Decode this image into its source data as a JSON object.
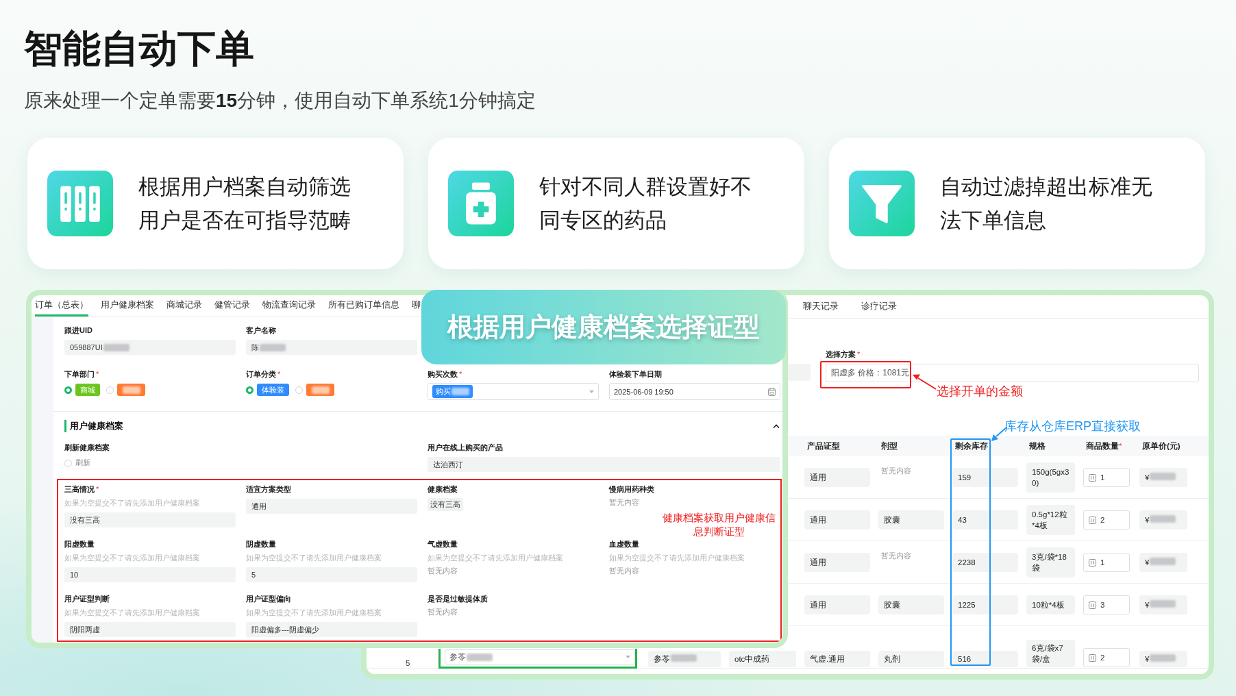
{
  "title": "智能自动下单",
  "subtitle": "原来处理一个定单需要**15**分钟，使用自动下单系统1分钟搞定",
  "features": [
    {
      "kind": "binders",
      "text": "根据用户档案自动筛选用户是否在可指导范畴"
    },
    {
      "kind": "bottle",
      "text": "针对不同人群设置好不同专区的药品"
    },
    {
      "kind": "funnel",
      "text": "自动过滤掉超出标准无法下单信息"
    }
  ],
  "banner": "根据用户健康档案选择证型",
  "order_window": {
    "tabs": [
      {
        "label": "订单（总表）",
        "selected": true
      },
      {
        "label": "用户健康档案",
        "selected": false
      },
      {
        "label": "商城记录",
        "selected": false
      },
      {
        "label": "健管记录",
        "selected": false
      },
      {
        "label": "物流查询记录",
        "selected": false
      },
      {
        "label": "所有已购订单信息",
        "selected": false
      },
      {
        "label": "聊",
        "selected": false
      }
    ],
    "rows": [
      [
        {
          "label": "跟进UID",
          "kind": "input",
          "value": "059887UI",
          "masked": true
        },
        {
          "label": "客户名称",
          "kind": "input",
          "value": "陈",
          "masked": true
        }
      ],
      [
        {
          "label": "下单部门",
          "required_mark": "*",
          "kind": "radio",
          "options": [
            {
              "label": "商城",
              "color": "#6cc51f",
              "selected": true
            },
            {
              "color": "#ff7a33",
              "selected": false,
              "masked": true
            }
          ]
        },
        {
          "label": "订单分类",
          "required_mark": "*",
          "kind": "radio",
          "options": [
            {
              "label": "体验装",
              "color": "#2f8cff",
              "selected": true
            },
            {
              "color": "#ff7a33",
              "selected": false,
              "masked": true
            }
          ]
        },
        {
          "label": "购买次数",
          "required_mark": "*",
          "kind": "select",
          "value": "购买",
          "masked": true
        },
        {
          "label": "体验装下单日期",
          "kind": "date",
          "value": "2025-06-09 19:50"
        }
      ]
    ],
    "health": {
      "title": "用户健康档案",
      "expanded": true,
      "refresh": {
        "label": "刷新健康档案",
        "kind": "radio",
        "options": [
          {
            "label": "刷新",
            "selected": false
          }
        ]
      },
      "purchased": {
        "label": "用户在线上购买的产品",
        "kind": "input",
        "value": "达泊西汀"
      },
      "note": "健康档案获取用户健康信息判断证型",
      "highlight_rows": [
        [
          {
            "label": "三高情况",
            "required_mark": "*",
            "hint": "如果为空提交不了请先添加用户健康档案",
            "kind": "input",
            "value": "没有三高"
          },
          {
            "label": "适宜方案类型",
            "kind": "input",
            "value": "通用"
          },
          {
            "label": "健康档案",
            "kind": "tag",
            "value": "没有三高"
          },
          {
            "label": "慢病用药种类",
            "kind": "text",
            "value": "暂无内容"
          }
        ],
        [
          {
            "label": "阳虚数量",
            "hint": "如果为空提交不了请先添加用户健康档案",
            "kind": "input",
            "value": "10"
          },
          {
            "label": "阴虚数量",
            "hint": "如果为空提交不了请先添加用户健康档案",
            "kind": "input",
            "value": "5"
          },
          {
            "label": "气虚数量",
            "hint": "如果为空提交不了请先添加用户健康档案",
            "kind": "text",
            "value": "暂无内容"
          },
          {
            "label": "血虚数量",
            "hint": "如果为空提交不了请先添加用户健康档案",
            "kind": "text",
            "value": "暂无内容"
          }
        ],
        [
          {
            "label": "用户证型判断",
            "hint": "如果为空提交不了请先添加用户健康档案",
            "kind": "input",
            "value": "阴阳两虚"
          },
          {
            "label": "用户证型偏向",
            "hint": "如果为空提交不了请先添加用户健康档案",
            "kind": "input",
            "value": "阳虚偏多---阴虚偏少"
          },
          {
            "label": "是否是过敏提体质",
            "kind": "text",
            "value": "暂无内容"
          }
        ]
      ]
    }
  },
  "plan_window": {
    "tabs": [
      {
        "label": "聊天记录",
        "selected": false
      },
      {
        "label": "诊疗记录",
        "selected": false
      }
    ],
    "plan": {
      "label": "选择方案",
      "required_mark": "*",
      "value": "阳虚多 价格：1081元"
    },
    "plan_note": "选择开单的金额",
    "stock_note": "库存从仓库ERP直接获取",
    "columns": [
      {
        "label": "产品证型"
      },
      {
        "label": "剂型"
      },
      {
        "label": "剩余库存",
        "highlighted": true
      },
      {
        "label": "规格"
      },
      {
        "label": "商品数量",
        "required_mark": "*"
      },
      {
        "label": "原单价(元)"
      }
    ],
    "rows": [
      {
        "syndrome": "通用",
        "form": "暂无内容",
        "form_empty": true,
        "stock": "159",
        "spec": "150g(5gx30)",
        "quantity": "1",
        "price": "¥",
        "price_masked": true
      },
      {
        "syndrome": "通用",
        "form": "胶囊",
        "form_empty": false,
        "stock": "43",
        "spec": "0.5g*12粒*4板",
        "quantity": "2",
        "price": "¥",
        "price_masked": true
      },
      {
        "syndrome": "通用",
        "form": "暂无内容",
        "form_empty": true,
        "stock": "2238",
        "spec": "3克/袋*18袋",
        "quantity": "1",
        "price": "¥",
        "price_masked": true
      },
      {
        "syndrome": "通用",
        "form": "胶囊",
        "form_empty": false,
        "stock": "1225",
        "spec": "10粒*4板",
        "quantity": "3",
        "price": "¥",
        "price_masked": true
      },
      {
        "index": "5",
        "product": "参苓",
        "product_masked": true,
        "name": "参苓",
        "name_masked": true,
        "category": "otc中成药",
        "syndrome": "气虚.通用",
        "form": "丸剂",
        "form_empty": false,
        "stock": "516",
        "spec": "6克/袋x7袋/盒",
        "quantity": "2",
        "price": "¥",
        "price_masked": true
      }
    ]
  }
}
